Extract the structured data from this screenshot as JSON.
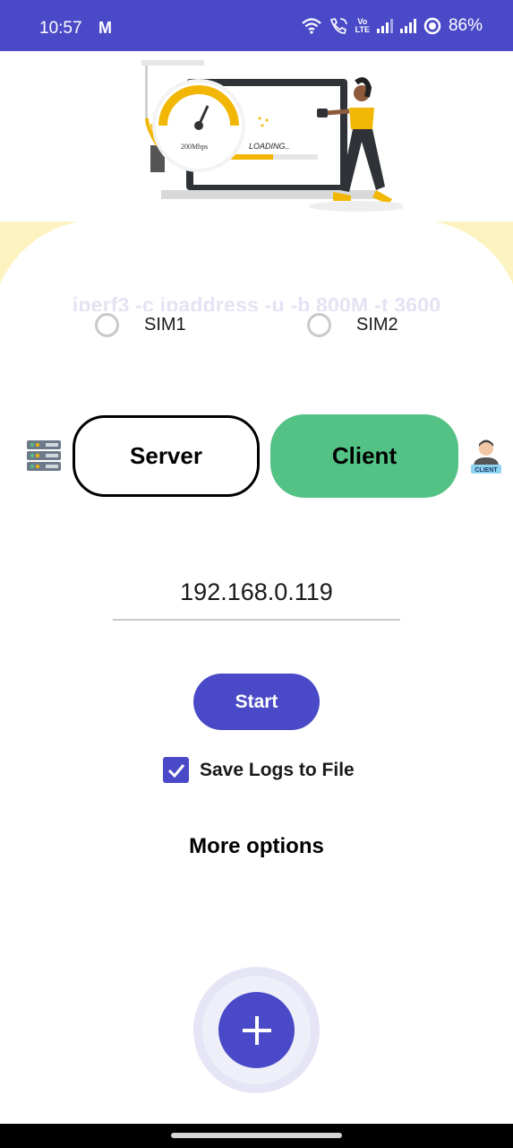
{
  "status_bar": {
    "time": "10:57",
    "gmail_icon": "M",
    "volte_line1": "Vo",
    "volte_line2": "LTE",
    "battery": "86%",
    "icons": [
      "gmail-icon",
      "wifi-icon",
      "wifi-calling-icon",
      "volte-icon",
      "signal-icon",
      "battery-icon"
    ]
  },
  "hero": {
    "illustration": {
      "speed_label": "200Mbps",
      "loading_label": "LOADING.."
    },
    "command": "iperf3 -c ipaddress -u -b 800M -t 3600"
  },
  "sim": {
    "options": [
      {
        "label": "SIM1",
        "selected": false
      },
      {
        "label": "SIM2",
        "selected": false
      }
    ]
  },
  "mode": {
    "server_label": "Server",
    "client_label": "Client",
    "selected": "Client",
    "client_icon_text": "CLIENT"
  },
  "ip_input": {
    "value": "192.168.0.119"
  },
  "start_label": "Start",
  "save_logs": {
    "label": "Save Logs to File",
    "checked": true
  },
  "more_options_label": "More options",
  "fab": {
    "icon": "plus-icon"
  },
  "colors": {
    "primary": "#4a4ac8",
    "client_selected": "#54c285",
    "hero_band": "#fdf3c0",
    "command_text": "#e3e3f4"
  }
}
